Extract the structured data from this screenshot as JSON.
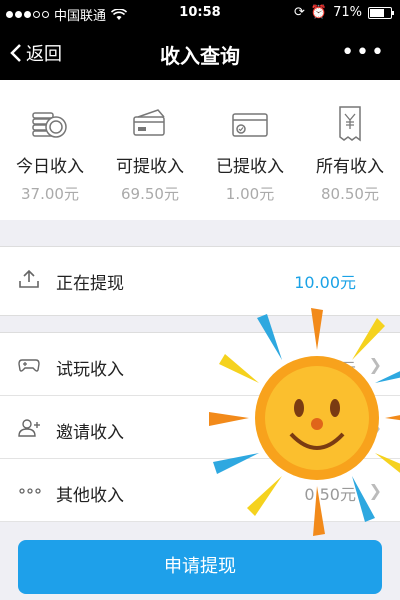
{
  "status_bar": {
    "carrier": "中国联通",
    "time": "10:58",
    "battery": "71%",
    "battery_level": 0.71
  },
  "nav": {
    "back_label": "返回",
    "title": "收入查询",
    "more_label": "•••"
  },
  "stats": [
    {
      "label": "今日收入",
      "value": "37.00元",
      "icon": "coins-icon"
    },
    {
      "label": "可提收入",
      "value": "69.50元",
      "icon": "card-icon"
    },
    {
      "label": "已提收入",
      "value": "1.00元",
      "icon": "bank-card-icon"
    },
    {
      "label": "所有收入",
      "value": "80.50元",
      "icon": "yen-receipt-icon"
    }
  ],
  "withdrawing": {
    "label": "正在提现",
    "value": "10.00元",
    "icon": "upload-icon"
  },
  "income_items": [
    {
      "label": "试玩收入",
      "value": "15.00元",
      "icon": "gamepad-icon"
    },
    {
      "label": "邀请收入",
      "value": "",
      "icon": "add-user-icon"
    },
    {
      "label": "其他收入",
      "value": "0.50元",
      "icon": "more-dots-icon"
    }
  ],
  "apply_button": {
    "label": "申请提现"
  },
  "colors": {
    "accent": "#1ea0ea",
    "nav_background": "#000000",
    "page_background": "#efeff4"
  }
}
